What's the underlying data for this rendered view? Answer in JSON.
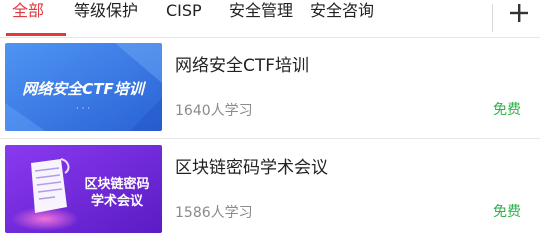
{
  "tabs": [
    {
      "label": "全部",
      "active": true
    },
    {
      "label": "等级保护",
      "active": false
    },
    {
      "label": "CISP",
      "active": false
    },
    {
      "label": "安全管理",
      "active": false
    },
    {
      "label": "安全咨询",
      "active": false
    }
  ],
  "add_button": {
    "icon": "plus-icon"
  },
  "courses": [
    {
      "title": "网络安全CTF培训",
      "learners": "1640人学习",
      "price": "免费",
      "thumbnail": {
        "text": "网络安全CTF培训",
        "dots": "· · ·",
        "background": "#3d7de8"
      }
    },
    {
      "title": "区块链密码学术会议",
      "learners": "1586人学习",
      "price": "免费",
      "thumbnail": {
        "line1": "区块链密码",
        "line2": "学术会议",
        "icon": "document-icon",
        "background": "#7a2be0"
      }
    }
  ],
  "colors": {
    "accent": "#e0393e",
    "free": "#2fb14a",
    "muted": "#8a8a8a"
  }
}
